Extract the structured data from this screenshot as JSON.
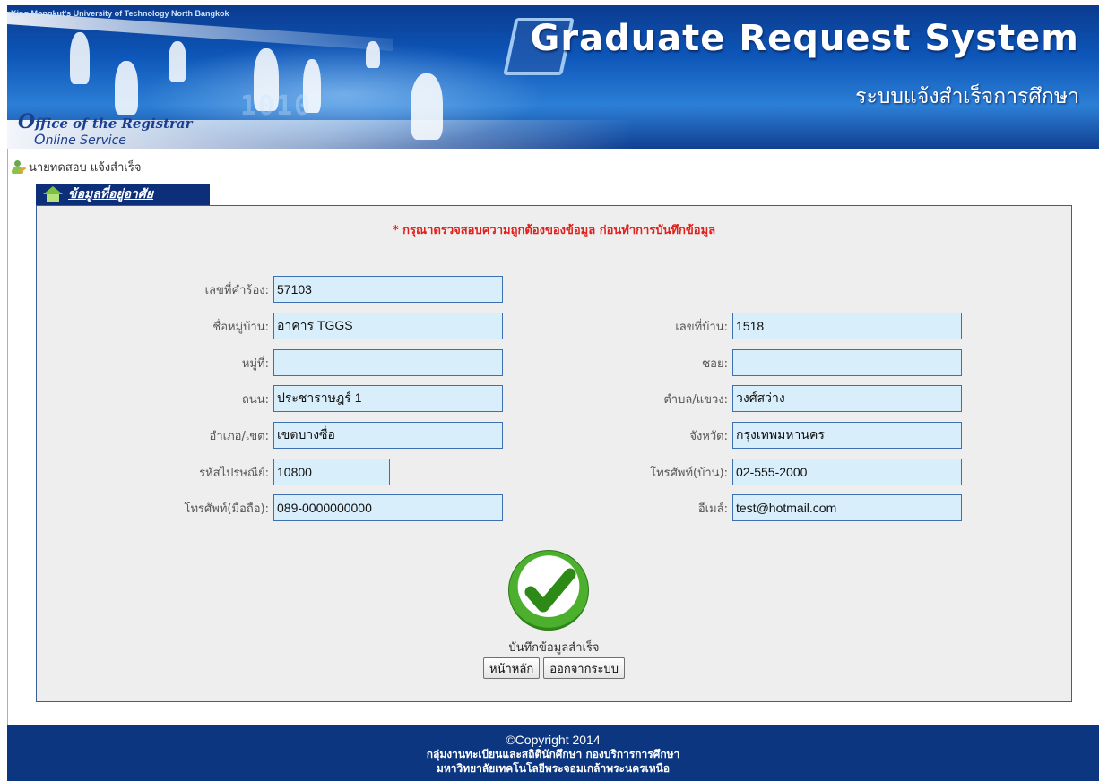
{
  "banner": {
    "university": "King Mongkut's University of Technology North Bangkok",
    "title": "Graduate Request System",
    "subtitle": "ระบบแจ้งสำเร็จการศึกษา",
    "office_line1": "ffice of the Registrar",
    "office_line2": "nline Service",
    "binary_text": "1010"
  },
  "user": {
    "name": "นายทดสอบ",
    "status": "แจ้งสำเร็จ"
  },
  "panel": {
    "title": "ข้อมูลที่อยู่อาศัย",
    "warning": "* กรุณาตรวจสอบความถูกต้องของข้อมูล ก่อนทำการบันทึกข้อมูล"
  },
  "form": {
    "request_no": {
      "label": "เลขที่คำร้อง:",
      "value": "57103"
    },
    "village": {
      "label": "ชื่อหมู่บ้าน:",
      "value": "อาคาร TGGS"
    },
    "house_no": {
      "label": "เลขที่บ้าน:",
      "value": "1518"
    },
    "moo": {
      "label": "หมู่ที่:",
      "value": ""
    },
    "soi": {
      "label": "ซอย:",
      "value": ""
    },
    "road": {
      "label": "ถนน:",
      "value": "ประชาราษฎร์ 1"
    },
    "subdistrict": {
      "label": "ตำบล/แขวง:",
      "value": "วงศ์สว่าง"
    },
    "district": {
      "label": "อำเภอ/เขต:",
      "value": "เขตบางซื่อ"
    },
    "province": {
      "label": "จังหวัด:",
      "value": "กรุงเทพมหานคร"
    },
    "postcode": {
      "label": "รหัสไปรษณีย์:",
      "value": "10800"
    },
    "home_phone": {
      "label": "โทรศัพท์(บ้าน):",
      "value": "02-555-2000"
    },
    "mobile": {
      "label": "โทรศัพท์(มือถือ):",
      "value": "089-0000000000"
    },
    "email": {
      "label": "อีเมล์:",
      "value": "test@hotmail.com"
    }
  },
  "result": {
    "message": "บันทึกข้อมูลสำเร็จ",
    "home_button": "หน้าหลัก",
    "logout_button": "ออกจากระบบ"
  },
  "footer": {
    "copyright": "©Copyright 2014",
    "department": "กลุ่มงานทะเบียนและสถิตินักศึกษา กองบริการการศึกษา",
    "university": "มหาวิทยาลัยเทคโนโลยีพระจอมเกล้าพระนครเหนือ"
  },
  "colors": {
    "banner": "#0d56b8",
    "panel_border": "#3a5f98",
    "input_bg": "#d9eefb",
    "warning": "#e0201b",
    "footer": "#0d3680"
  }
}
